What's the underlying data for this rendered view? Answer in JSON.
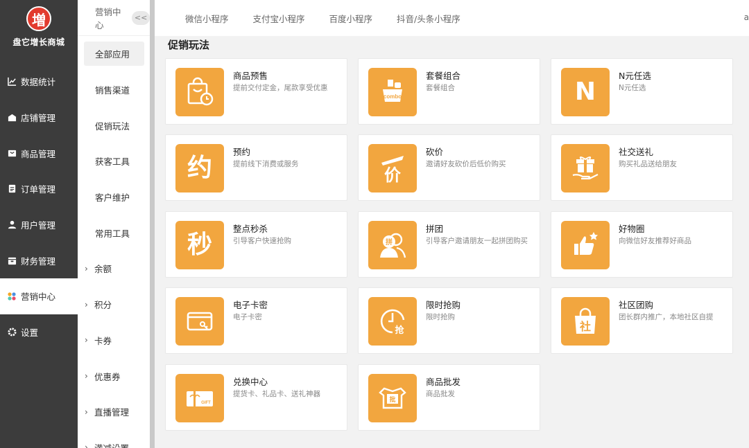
{
  "logo": {
    "glyph": "増",
    "name": "盘它增长商城"
  },
  "sidebar": {
    "items": [
      {
        "label": "数据统计",
        "icon": "chart-icon"
      },
      {
        "label": "店铺管理",
        "icon": "store-icon"
      },
      {
        "label": "商品管理",
        "icon": "product-icon"
      },
      {
        "label": "订单管理",
        "icon": "order-icon"
      },
      {
        "label": "用户管理",
        "icon": "user-icon"
      },
      {
        "label": "财务管理",
        "icon": "finance-icon"
      },
      {
        "label": "营销中心",
        "icon": "marketing-icon"
      },
      {
        "label": "设置",
        "icon": "gear-icon"
      }
    ],
    "active": "营销中心"
  },
  "submenu": {
    "header": "营销中心",
    "collapse": "<<",
    "items": [
      "全部应用",
      "销售渠道",
      "促销玩法",
      "获客工具",
      "客户维护",
      "常用工具"
    ],
    "expandable": [
      "余额",
      "积分",
      "卡券",
      "优惠券",
      "直播管理",
      "満减设置"
    ]
  },
  "tabs": [
    "微信小程序",
    "支付宝小程序",
    "百度小程序",
    "抖音/头条小程序"
  ],
  "top_edge_text": "a",
  "section_title": "促销玩法",
  "cards": [
    {
      "title": "商品预售",
      "desc": "提前交付定金，尾款享受优惠",
      "icon": "presale-bag-icon"
    },
    {
      "title": "套餐组合",
      "desc": "套餐组合",
      "icon": "combo-icon",
      "icon_text": "combo"
    },
    {
      "title": "N元任选",
      "desc": "N元任选",
      "icon": "n-letter-icon",
      "glyph": "N"
    },
    {
      "title": "预约",
      "desc": "提前线下消费或服务",
      "icon": "reservation-icon",
      "glyph": "约"
    },
    {
      "title": "砍价",
      "desc": "邀请好友砍价后低价购买",
      "icon": "bargain-icon",
      "glyph": "价"
    },
    {
      "title": "社交送礼",
      "desc": "购买礼品送给朋友",
      "icon": "gift-hand-icon"
    },
    {
      "title": "整点秒杀",
      "desc": "引导客户快速抢购",
      "icon": "flash-sale-icon",
      "glyph": "秒"
    },
    {
      "title": "拼团",
      "desc": "引导客户邀请朋友一起拼团购买",
      "icon": "group-buy-icon",
      "glyph": "拼"
    },
    {
      "title": "好物圈",
      "desc": "向微信好友推荐好商品",
      "icon": "thumbs-up-icon"
    },
    {
      "title": "电子卡密",
      "desc": "电子卡密",
      "icon": "card-key-icon"
    },
    {
      "title": "限时抢购",
      "desc": "限时抢购",
      "icon": "clock-icon",
      "glyph": "抢"
    },
    {
      "title": "社区团购",
      "desc": "团长群内推广，本地社区自提",
      "icon": "community-bag-icon",
      "glyph": "社"
    },
    {
      "title": "兑换中心",
      "desc": "提货卡、礼品卡、送礼神器",
      "icon": "gift-card-icon",
      "icon_text": "GIFT"
    },
    {
      "title": "商品批发",
      "desc": "商品批发",
      "icon": "wholesale-shirt-icon",
      "glyph": "批"
    }
  ],
  "colors": {
    "sidebar_bg": "#3c3c3c",
    "icon_bg": "#f2a63f",
    "logo_red": "#e23b2e"
  }
}
